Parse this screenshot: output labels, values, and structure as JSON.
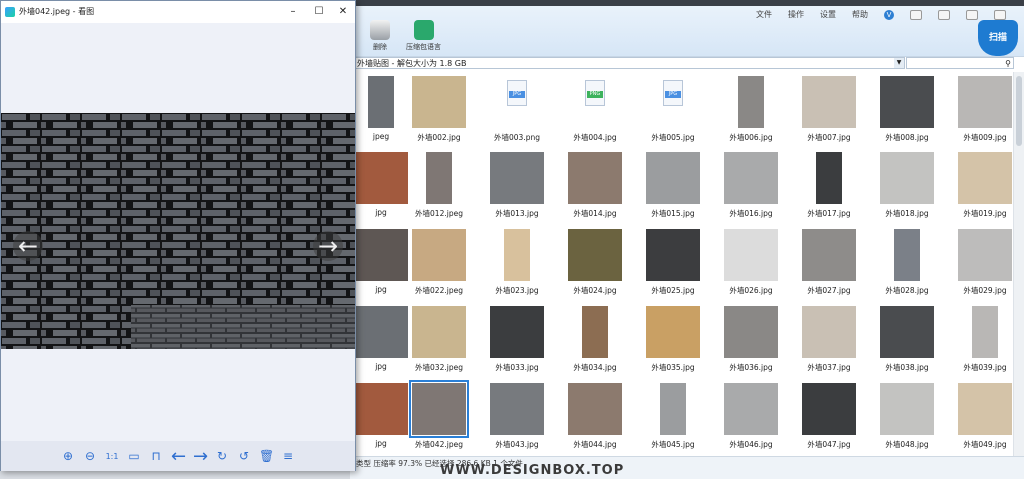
{
  "viewer": {
    "title": "外墙042.jpeg - 看图",
    "toolbar": [
      "zoom-in",
      "zoom-out",
      "actual-size",
      "open-folder",
      "slideshow",
      "previous",
      "next",
      "rotate-right",
      "rotate-left",
      "delete",
      "more"
    ]
  },
  "archive": {
    "menu": [
      "文件",
      "操作",
      "设置",
      "帮助"
    ],
    "tools": [
      {
        "label": "删除"
      },
      {
        "label": "压缩包语言"
      }
    ],
    "shield_label": "扫描",
    "path": "外墙贴图 - 解包大小为 1.8 GB",
    "status": "类型 压缩率 97.3% 已经选择 286.6 KB 1 个文件",
    "files": [
      [
        "jpeg",
        "外墙002.jpg",
        "外墙003.png",
        "外墙004.jpg",
        "外墙005.jpg",
        "外墙006.jpg",
        "外墙007.jpg",
        "外墙008.jpg",
        "外墙009.jpg"
      ],
      [
        "jpg",
        "外墙012.jpeg",
        "外墙013.jpg",
        "外墙014.jpg",
        "外墙015.jpg",
        "外墙016.jpg",
        "外墙017.jpg",
        "外墙018.jpg",
        "外墙019.jpg"
      ],
      [
        "jpg",
        "外墙022.jpeg",
        "外墙023.jpg",
        "外墙024.jpg",
        "外墙025.jpg",
        "外墙026.jpg",
        "外墙027.jpg",
        "外墙028.jpg",
        "外墙029.jpg"
      ],
      [
        "jpg",
        "外墙032.jpeg",
        "外墙033.jpg",
        "外墙034.jpg",
        "外墙035.jpg",
        "外墙036.jpg",
        "外墙037.jpg",
        "外墙038.jpg",
        "外墙039.jpg"
      ],
      [
        "jpg",
        "外墙042.jpeg",
        "外墙043.jpg",
        "外墙044.jpg",
        "外墙045.jpg",
        "外墙046.jpg",
        "外墙047.jpg",
        "外墙048.jpg",
        "外墙049.jpg"
      ]
    ]
  },
  "watermark": "WWW.DESIGNBOX.TOP",
  "colors": {
    "accent": "#2a7fd6",
    "viewer_bg": "#eef1f8",
    "toolbar_icon": "#2f6fd0"
  }
}
